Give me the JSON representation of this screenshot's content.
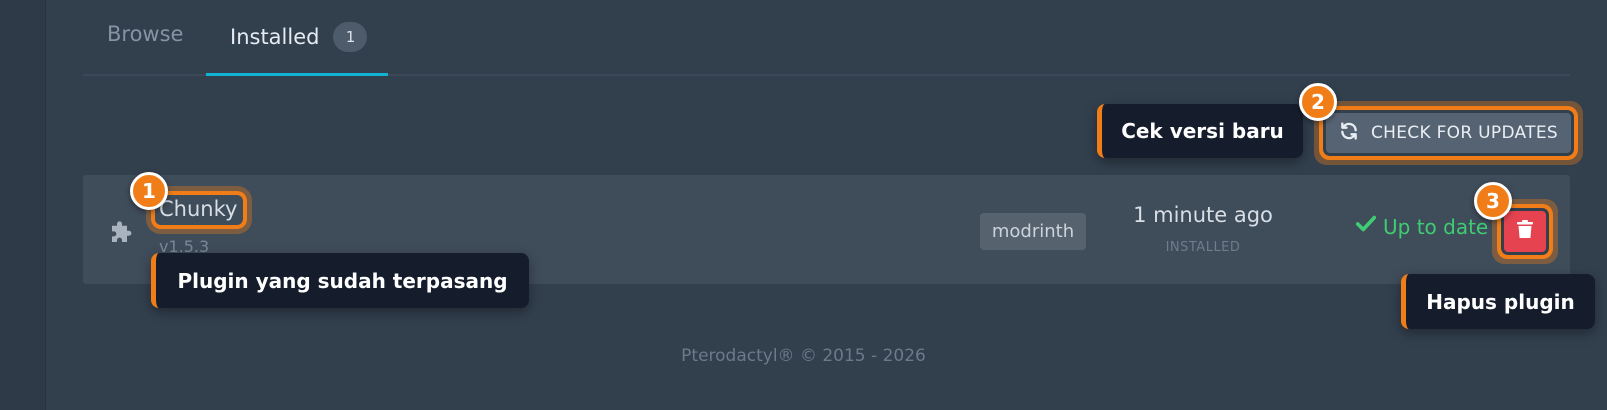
{
  "tabs": {
    "browse": "Browse",
    "installed": "Installed",
    "installed_count": "1"
  },
  "toolbar": {
    "check_updates_label": "CHECK FOR UPDATES"
  },
  "plugin": {
    "name": "Chunky",
    "version": "v1.5.3",
    "source": "modrinth",
    "installed_time": "1 minute ago",
    "installed_label": "INSTALLED",
    "status": "Up to date"
  },
  "annotations": {
    "step1": {
      "number": "1",
      "text": "Plugin yang sudah terpasang"
    },
    "step2": {
      "number": "2",
      "text": "Cek versi baru"
    },
    "step3": {
      "number": "3",
      "text": "Hapus plugin"
    }
  },
  "footer": "Pterodactyl® © 2015 - 2026",
  "colors": {
    "background": "#323f4d",
    "row": "#3f4c5a",
    "accent_tab": "#11b3d3",
    "annotation": "#f07d18",
    "danger": "#e4434f",
    "success": "#3fcd73"
  },
  "icons": {
    "plugin": "puzzle-icon",
    "refresh": "refresh-icon",
    "status": "check-icon",
    "delete": "trash-icon"
  }
}
